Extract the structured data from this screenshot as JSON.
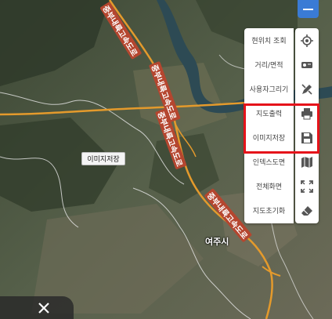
{
  "toolbar": {
    "collapse_icon": "minus-icon",
    "items": [
      {
        "label": "현위치 조회",
        "icon": "locate-icon"
      },
      {
        "label": "거리/면적",
        "icon": "measure-icon"
      },
      {
        "label": "사용자그리기",
        "icon": "draw-icon"
      },
      {
        "label": "지도출력",
        "icon": "print-icon"
      },
      {
        "label": "이미지저장",
        "icon": "save-icon"
      },
      {
        "label": "인덱스도면",
        "icon": "map-index-icon"
      },
      {
        "label": "전체화면",
        "icon": "fullscreen-icon"
      },
      {
        "label": "지도초기화",
        "icon": "eraser-icon"
      }
    ],
    "highlight_color": "#e5131a"
  },
  "map": {
    "tooltip": "이미지저장",
    "city_label": "여주시",
    "highway_labels": [
      "중부내륙고속도로",
      "중부내륙고속도로",
      "중부내륙고속도로",
      "중부내륙고속도로"
    ],
    "road_color": "#e49a2c",
    "river_color": "#2d4a54"
  },
  "close_button": {
    "icon": "close-icon"
  }
}
